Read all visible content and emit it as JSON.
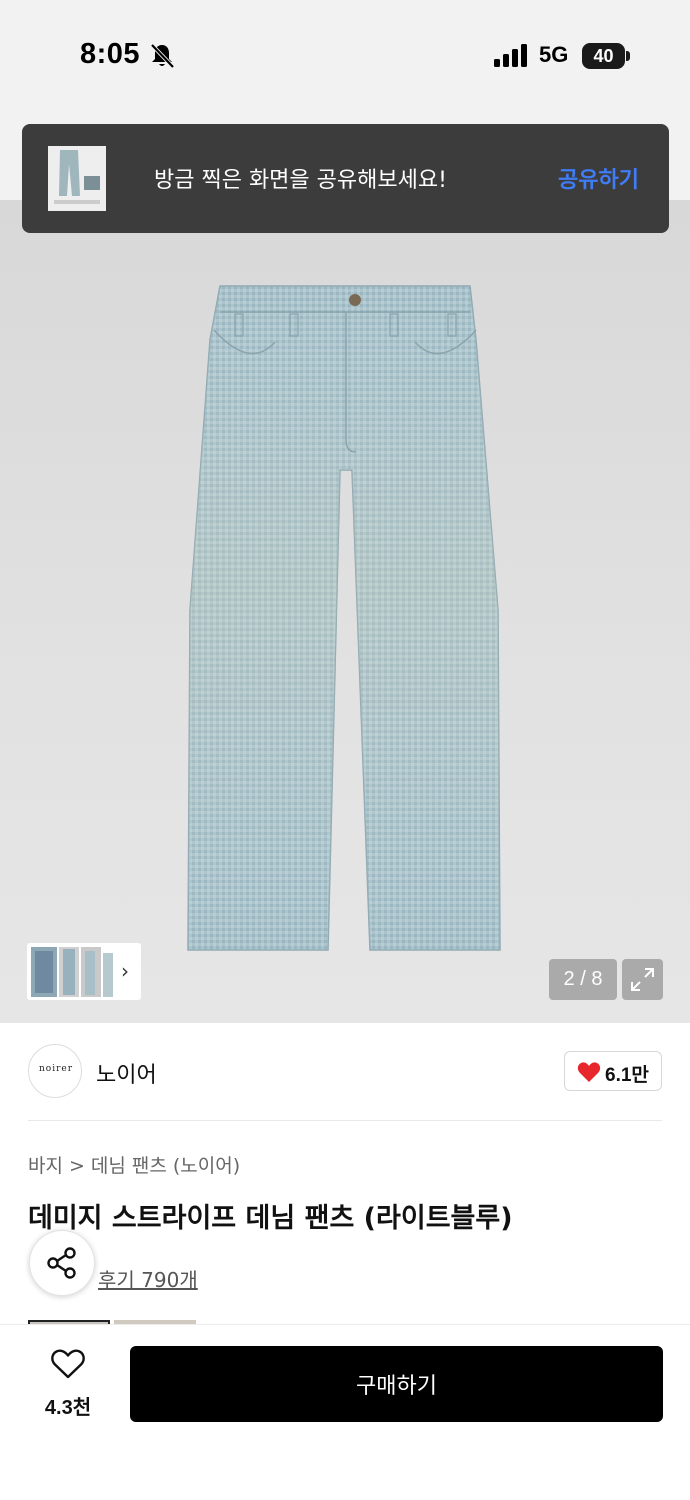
{
  "status_bar": {
    "time": "8:05",
    "network": "5G",
    "battery": "40",
    "icons": [
      "bell-off-icon",
      "signal-icon",
      "battery-icon"
    ]
  },
  "toast": {
    "message": "방금 찍은 화면을 공유해보세요!",
    "action_label": "공유하기",
    "action_color": "#3f7cf5"
  },
  "gallery": {
    "counter": "2 / 8",
    "expand_icon": "expand-icon",
    "thumb_chevron": "›"
  },
  "brand": {
    "logo_text": "noirer",
    "name": "노이어",
    "like_count": "6.1만",
    "like_icon_color": "#e8272d"
  },
  "breadcrumb": {
    "level1": "바지",
    "separator": ">",
    "level2": "데님 팬츠 (노이어)"
  },
  "product": {
    "title": "데미지 스트라이프 데님 팬츠 (라이트블루)",
    "review_link": "후기 790개"
  },
  "bottom_bar": {
    "wish_count": "4.3천",
    "buy_label": "구매하기"
  }
}
